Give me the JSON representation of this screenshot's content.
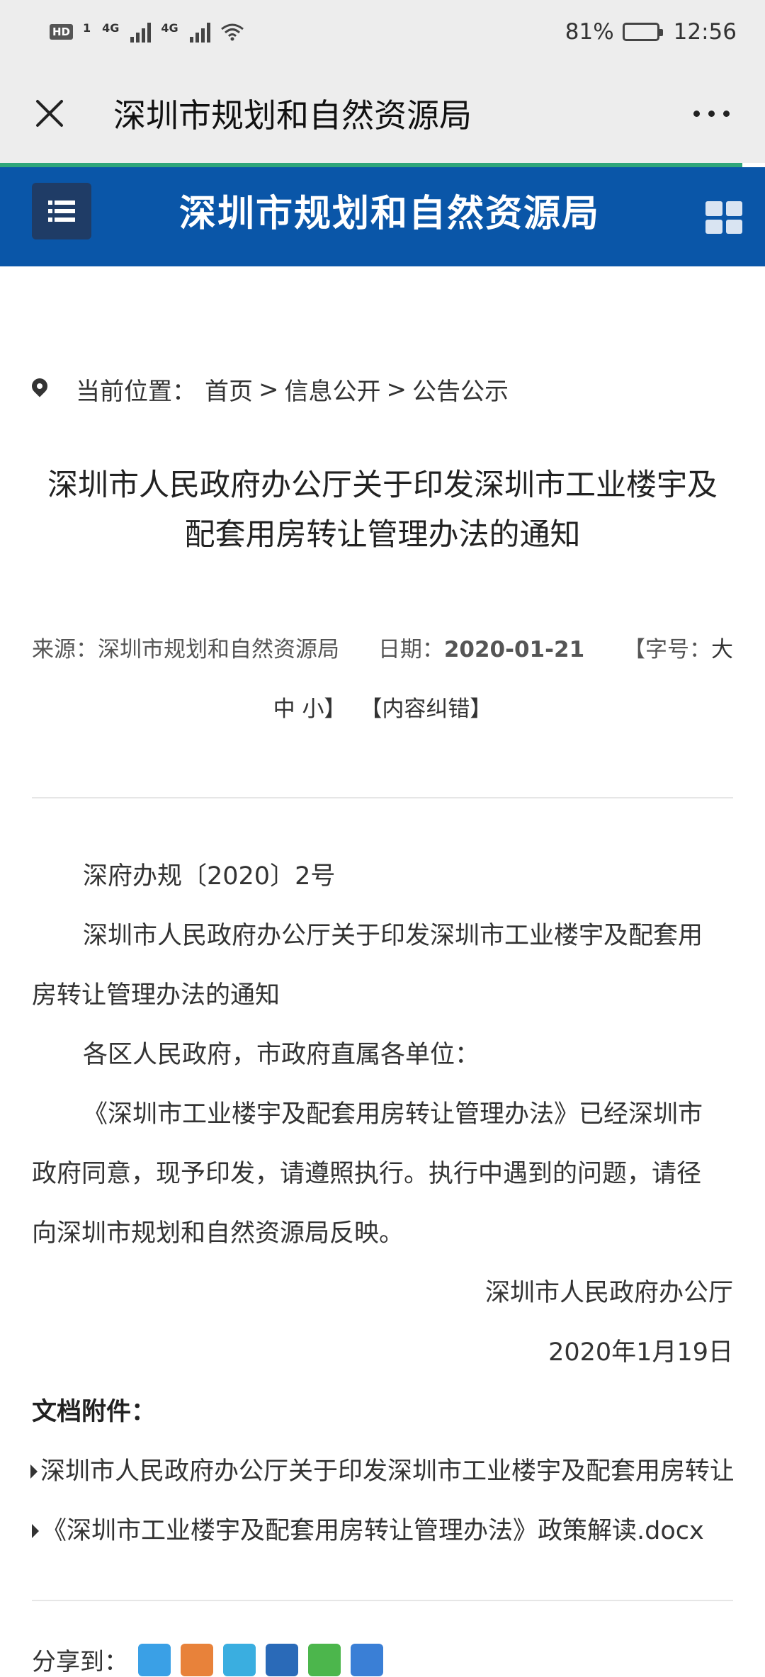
{
  "status_bar": {
    "hd": "HD",
    "sim1": "1",
    "net1": "4G",
    "net2": "4G",
    "battery": "81%",
    "battery_level": 0.81,
    "time": "12:56"
  },
  "title_bar": {
    "title": "深圳市规划和自然资源局"
  },
  "site_header": {
    "title": "深圳市规划和自然资源局",
    "bg_color": "#0a56a8",
    "accent_color": "#2fa67a"
  },
  "breadcrumb": {
    "label": "当前位置：",
    "items": [
      "首页",
      "信息公开",
      "公告公示"
    ],
    "separator": ">"
  },
  "article": {
    "title_line1": "深圳市人民政府办公厅关于印发深圳市工业楼宇及",
    "title_line2": "配套用房转让管理办法的通知",
    "source_label": "来源：",
    "source": "深圳市规划和自然资源局",
    "date_label": "日期：",
    "date": "2020-01-21",
    "font_label": "【字号：",
    "font_large": "大",
    "font_medium": "中",
    "font_small": "小",
    "font_close": "】",
    "error_link": "【内容纠错】"
  },
  "body": {
    "doc_no": "深府办规〔2020〕2号",
    "heading_line1": "深圳市人民政府办公厅关于印发深圳市工业楼宇及配套用",
    "heading_line2": "房转让管理办法的通知",
    "salutation": "各区人民政府，市政府直属各单位：",
    "para_line1": "《深圳市工业楼宇及配套用房转让管理办法》已经深圳市",
    "para_line2": "政府同意，现予印发，请遵照执行。执行中遇到的问题，请径",
    "para_line3": "向深圳市规划和自然资源局反映。",
    "signer": "深圳市人民政府办公厅",
    "sign_date": "2020年1月19日"
  },
  "attachments": {
    "label": "文档附件：",
    "items": [
      "深圳市人民政府办公厅关于印发深圳市工业楼宇及配套用房转让管",
      "《深圳市工业楼宇及配套用房转让管理办法》政策解读.docx"
    ]
  },
  "share": {
    "label": "分享到：",
    "colors": [
      "#3aa0e6",
      "#e8823a",
      "#3aaee0",
      "#2a6ab8",
      "#4cb64c",
      "#3a7fd6"
    ]
  }
}
